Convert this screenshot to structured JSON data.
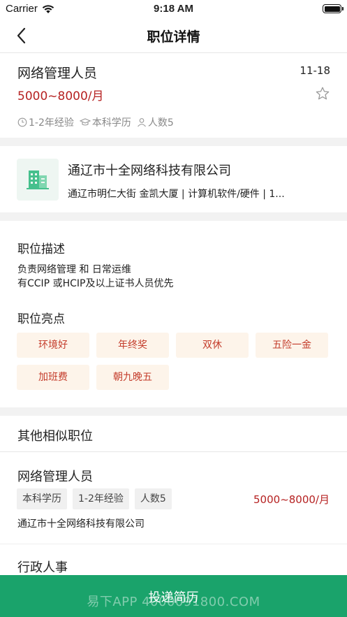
{
  "status_bar": {
    "carrier": "Carrier",
    "time": "9:18 AM"
  },
  "nav": {
    "title": "职位详情"
  },
  "job": {
    "title": "网络管理人员",
    "date": "11-18",
    "salary": "5000~8000/月",
    "experience": "1-2年经验",
    "education": "本科学历",
    "headcount": "人数5"
  },
  "company": {
    "name": "通辽市十全网络科技有限公司",
    "info": "通辽市明仁大街 金凯大厦  | 计算机软件/硬件 | 1..."
  },
  "description": {
    "title": "职位描述",
    "lines": [
      "负责网络管理 和 日常运维",
      "有CCIP 或HCIP及以上证书人员优先"
    ]
  },
  "highlights": {
    "title": "职位亮点",
    "tags": [
      "环境好",
      "年终奖",
      "双休",
      "五险一金",
      "加班费",
      "朝九晚五"
    ]
  },
  "similar": {
    "title": "其他相似职位",
    "items": [
      {
        "name": "网络管理人员",
        "pills": [
          "本科学历",
          "1-2年经验",
          "人数5"
        ],
        "salary": "5000~8000/月",
        "company": "通辽市十全网络科技有限公司"
      },
      {
        "name": "行政人事"
      }
    ]
  },
  "apply": {
    "label": "投递简历"
  },
  "watermark": "易下APP  4000091800.COM",
  "colors": {
    "accent": "#1aa36b",
    "salary": "#b62222",
    "tag_bg": "#fdf4ea",
    "tag_text": "#c43c2b"
  }
}
